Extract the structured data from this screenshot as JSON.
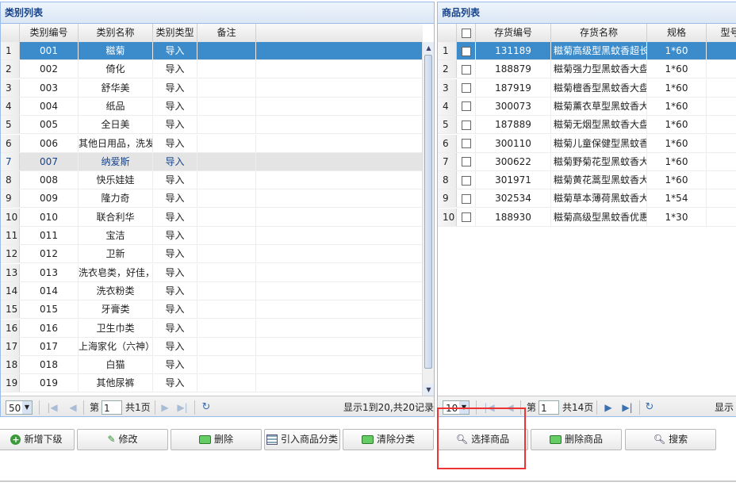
{
  "left_panel": {
    "title": "类别列表",
    "columns": [
      "类别编号",
      "类别名称",
      "类别类型",
      "备注"
    ],
    "rows": [
      {
        "n": "1",
        "code": "001",
        "name": "糍菊",
        "type": "导入",
        "note": ""
      },
      {
        "n": "2",
        "code": "002",
        "name": "倚化",
        "type": "导入",
        "note": ""
      },
      {
        "n": "3",
        "code": "003",
        "name": "舒华美",
        "type": "导入",
        "note": ""
      },
      {
        "n": "4",
        "code": "004",
        "name": "纸品",
        "type": "导入",
        "note": ""
      },
      {
        "n": "5",
        "code": "005",
        "name": "全日美",
        "type": "导入",
        "note": ""
      },
      {
        "n": "6",
        "code": "006",
        "name": "其他日用品，洗发",
        "type": "导入",
        "note": ""
      },
      {
        "n": "7",
        "code": "007",
        "name": "纳爱斯",
        "type": "导入",
        "note": ""
      },
      {
        "n": "8",
        "code": "008",
        "name": "快乐娃娃",
        "type": "导入",
        "note": ""
      },
      {
        "n": "9",
        "code": "009",
        "name": "隆力奇",
        "type": "导入",
        "note": ""
      },
      {
        "n": "10",
        "code": "010",
        "name": "联合利华",
        "type": "导入",
        "note": ""
      },
      {
        "n": "11",
        "code": "011",
        "name": "宝洁",
        "type": "导入",
        "note": ""
      },
      {
        "n": "12",
        "code": "012",
        "name": "卫新",
        "type": "导入",
        "note": ""
      },
      {
        "n": "13",
        "code": "013",
        "name": "洗衣皂类，好佳，",
        "type": "导入",
        "note": ""
      },
      {
        "n": "14",
        "code": "014",
        "name": "洗衣粉类",
        "type": "导入",
        "note": ""
      },
      {
        "n": "15",
        "code": "015",
        "name": "牙膏类",
        "type": "导入",
        "note": ""
      },
      {
        "n": "16",
        "code": "016",
        "name": "卫生巾类",
        "type": "导入",
        "note": ""
      },
      {
        "n": "17",
        "code": "017",
        "name": "上海家化（六神）",
        "type": "导入",
        "note": ""
      },
      {
        "n": "18",
        "code": "018",
        "name": "白猫",
        "type": "导入",
        "note": ""
      },
      {
        "n": "19",
        "code": "019",
        "name": "其他尿裤",
        "type": "导入",
        "note": ""
      }
    ],
    "pager": {
      "page_size": "50",
      "page_prefix": "第",
      "page_value": "1",
      "page_total": "共1页",
      "display_info": "显示1到20,共20记录"
    }
  },
  "right_panel": {
    "title": "商品列表",
    "columns": [
      "存货编号",
      "存货名称",
      "规格",
      "型号"
    ],
    "rows": [
      {
        "n": "1",
        "code": "131189",
        "name": "糍菊高级型黑蚊香超长装",
        "spec": "1*60"
      },
      {
        "n": "2",
        "code": "188879",
        "name": "糍菊强力型黑蚊香大盘装",
        "spec": "1*60"
      },
      {
        "n": "3",
        "code": "187919",
        "name": "糍菊檀香型黑蚊香大盘装",
        "spec": "1*60"
      },
      {
        "n": "4",
        "code": "300073",
        "name": "糍菊薰衣草型黑蚊香大盘",
        "spec": "1*60"
      },
      {
        "n": "5",
        "code": "187889",
        "name": "糍菊无烟型黑蚊香大盘装",
        "spec": "1*60"
      },
      {
        "n": "6",
        "code": "300110",
        "name": "糍菊儿童保健型黑蚊香大",
        "spec": "1*60"
      },
      {
        "n": "7",
        "code": "300622",
        "name": "糍菊野菊花型黑蚊香大盘",
        "spec": "1*60"
      },
      {
        "n": "8",
        "code": "301971",
        "name": "糍菊黄花蒿型黑蚊香大盘",
        "spec": "1*60"
      },
      {
        "n": "9",
        "code": "302534",
        "name": "糍菊草本薄荷黑蚊香大盘",
        "spec": "1*54"
      },
      {
        "n": "10",
        "code": "188930",
        "name": "糍菊高级型黑蚊香优惠装",
        "spec": "1*30"
      }
    ],
    "pager": {
      "page_size": "10",
      "page_prefix": "第",
      "page_value": "1",
      "page_total": "共14页",
      "display_info": "显示"
    }
  },
  "toolbar": {
    "add_child": "新增下级",
    "edit": "修改",
    "delete": "删除",
    "import_category": "引入商品分类",
    "clear_category": "清除分类",
    "select_goods": "选择商品",
    "delete_goods": "删除商品",
    "search": "搜索"
  },
  "colors": {
    "selected_row": "#3c8ccc",
    "panel_border": "#99bbe8",
    "highlight_box": "#e33333"
  }
}
